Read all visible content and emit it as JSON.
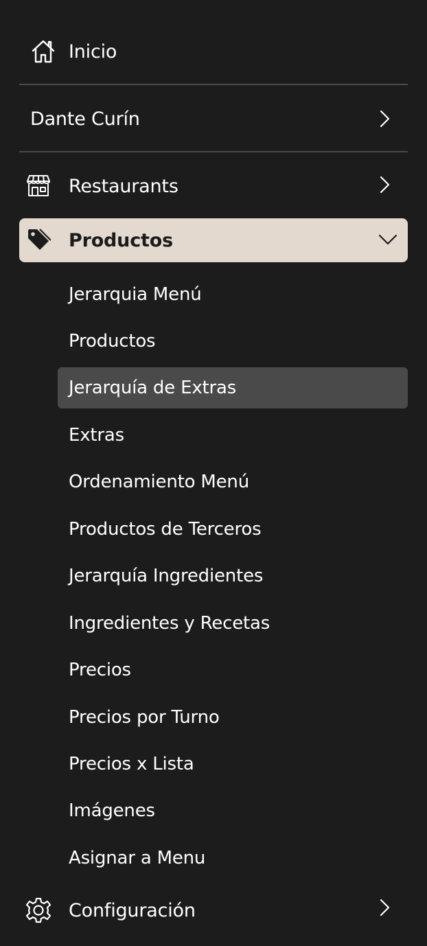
{
  "nav": {
    "home": {
      "label": "Inicio",
      "icon": "home-icon"
    },
    "user": {
      "label": "Dante Curín",
      "icon": "chevron-right-icon"
    },
    "restaurants": {
      "label": "Restaurants",
      "icon": "store-icon"
    },
    "productos": {
      "label": "Productos",
      "icon": "tag-icon",
      "expanded": true,
      "items": [
        {
          "label": "Jerarquia Menú"
        },
        {
          "label": "Productos"
        },
        {
          "label": "Jerarquía de Extras",
          "selected": true
        },
        {
          "label": "Extras"
        },
        {
          "label": "Ordenamiento Menú"
        },
        {
          "label": "Productos de Terceros"
        },
        {
          "label": "Jerarquía Ingredientes"
        },
        {
          "label": "Ingredientes y Recetas"
        },
        {
          "label": "Precios"
        },
        {
          "label": "Precios por Turno"
        },
        {
          "label": "Precios x Lista"
        },
        {
          "label": "Imágenes"
        },
        {
          "label": "Asignar a Menu"
        }
      ]
    },
    "configuracion": {
      "label": "Configuración",
      "icon": "gear-icon"
    }
  },
  "colors": {
    "background": "#1c1c1c",
    "active_group": "#e3d9cf",
    "selected_item": "#4a4a4a",
    "divider": "#4a4a4a",
    "text": "#ffffff",
    "text_dark": "#1c1c1c"
  }
}
